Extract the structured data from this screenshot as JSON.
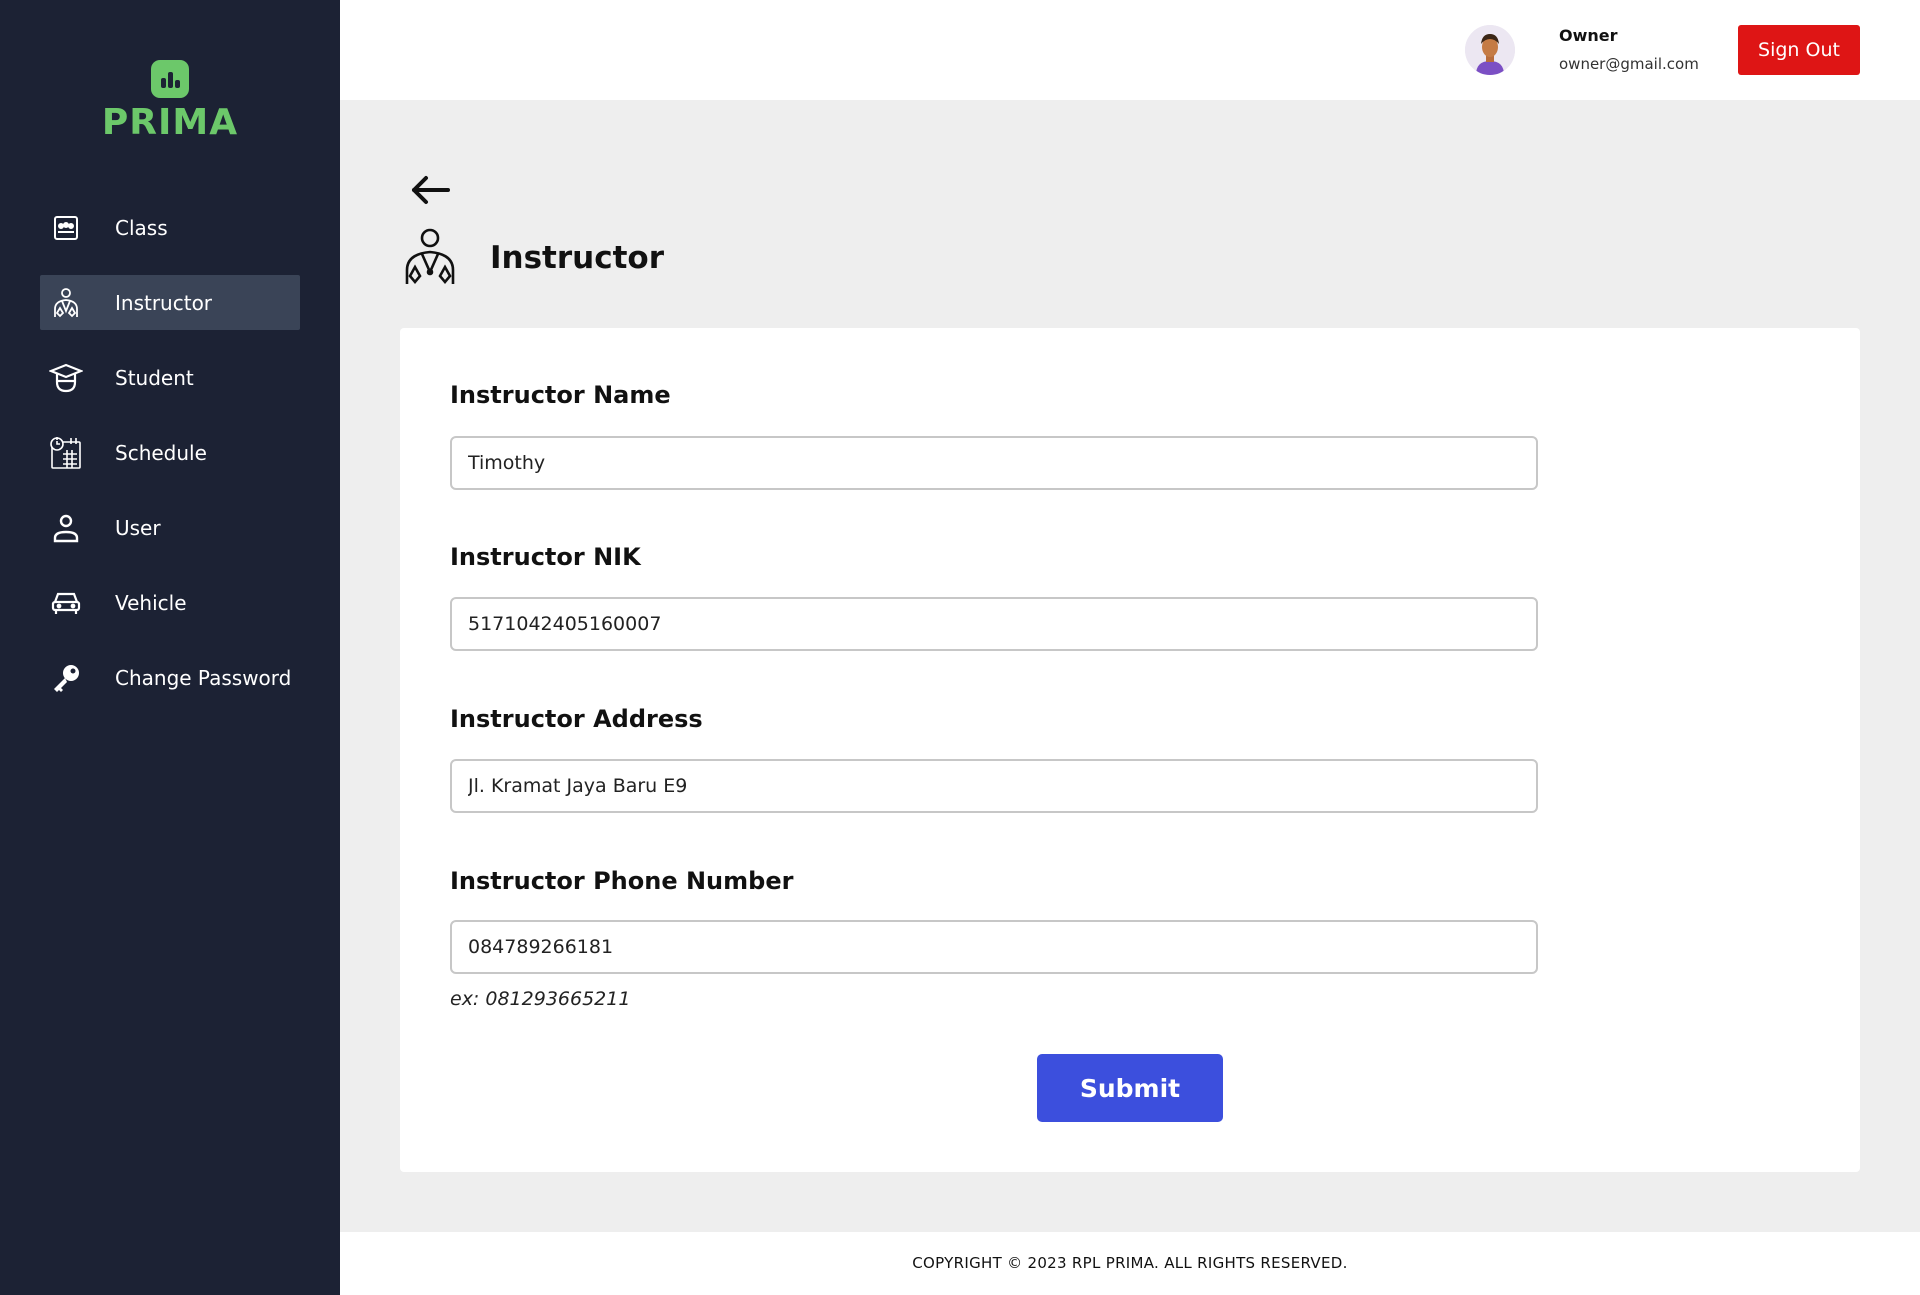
{
  "brand": {
    "name": "PRIMA",
    "color": "#6cc86a"
  },
  "sidebar": {
    "items": [
      {
        "label": "Class",
        "icon": "class-icon",
        "active": false
      },
      {
        "label": "Instructor",
        "icon": "instructor-icon",
        "active": true
      },
      {
        "label": "Student",
        "icon": "student-cap-icon",
        "active": false
      },
      {
        "label": "Schedule",
        "icon": "schedule-calendar-icon",
        "active": false
      },
      {
        "label": "User",
        "icon": "user-icon",
        "active": false
      },
      {
        "label": "Vehicle",
        "icon": "car-icon",
        "active": false
      },
      {
        "label": "Change Password",
        "icon": "key-icon",
        "active": false
      }
    ]
  },
  "header": {
    "user_name": "Owner",
    "user_email": "owner@gmail.com",
    "signout_label": "Sign Out",
    "signout_color": "#de1515"
  },
  "page": {
    "title": "Instructor"
  },
  "form": {
    "fields": [
      {
        "label": "Instructor Name",
        "value": "Timothy"
      },
      {
        "label": "Instructor NIK",
        "value": "5171042405160007"
      },
      {
        "label": "Instructor Address",
        "value": "Jl. Kramat Jaya Baru E9"
      },
      {
        "label": "Instructor Phone Number",
        "value": "084789266181"
      }
    ],
    "phone_hint": "ex: 081293665211",
    "submit_label": "Submit",
    "submit_color": "#3c4fdd"
  },
  "footer": {
    "copyright": "COPYRIGHT © 2023 RPL PRIMA. ALL RIGHTS RESERVED."
  }
}
